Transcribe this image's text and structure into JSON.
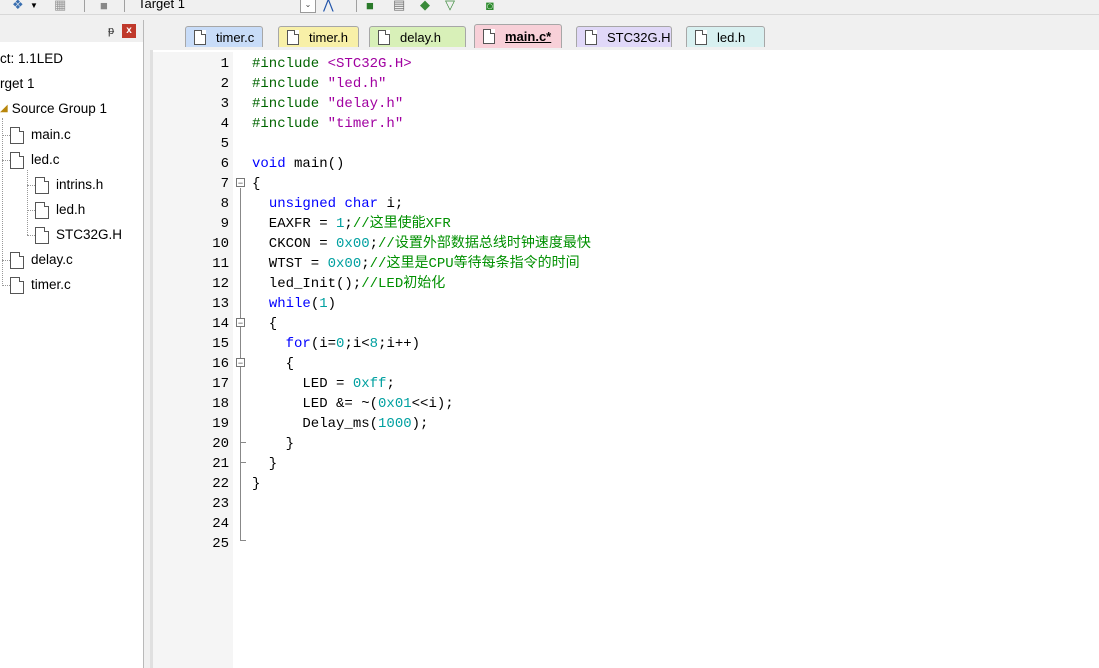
{
  "toolbar": {
    "target": "Target 1"
  },
  "project": {
    "root": "ct: 1.1LED",
    "target": "rget 1",
    "group": "Source Group 1",
    "files": [
      {
        "name": "main.c"
      },
      {
        "name": "led.c",
        "children": [
          "intrins.h",
          "led.h",
          "STC32G.H"
        ]
      },
      {
        "name": "delay.c"
      },
      {
        "name": "timer.c"
      }
    ],
    "pin_icon": "pin-icon",
    "close_icon": "close-icon"
  },
  "tabs": [
    {
      "label": "timer.c",
      "color": "#c8dcf8"
    },
    {
      "label": "timer.h",
      "color": "#f8f0a8"
    },
    {
      "label": "delay.h",
      "color": "#d8f0b8"
    },
    {
      "label": "main.c*",
      "color": "#f8d0d8",
      "active": true
    },
    {
      "label": "STC32G.H",
      "color": "#e0d8f8"
    },
    {
      "label": "led.h",
      "color": "#d8f0f0"
    }
  ],
  "editor": {
    "line_numbers": [
      "1",
      "2",
      "3",
      "4",
      "5",
      "6",
      "7",
      "8",
      "9",
      "10",
      "11",
      "12",
      "13",
      "14",
      "15",
      "16",
      "17",
      "18",
      "19",
      "20",
      "21",
      "22",
      "23",
      "24",
      "25"
    ],
    "lines": [
      "#include <STC32G.H>",
      "#include \"led.h\"",
      "#include \"delay.h\"",
      "#include \"timer.h\"",
      "",
      "void main()",
      "{",
      "  unsigned char i;",
      "  EAXFR = 1;//这里使能XFR",
      "  CKCON = 0x00;//设置外部数据总线时钟速度最快",
      "  WTST = 0x00;//这里是CPU等待每条指令的时间",
      "  led_Init();//LED初始化",
      "  while(1)",
      "  {",
      "    for(i=0;i<8;i++)",
      "    {",
      "      LED = 0xff;",
      "      LED &= ~(0x01<<i);",
      "      Delay_ms(1000);",
      "    }",
      "  }",
      "}",
      "",
      "",
      ""
    ]
  }
}
